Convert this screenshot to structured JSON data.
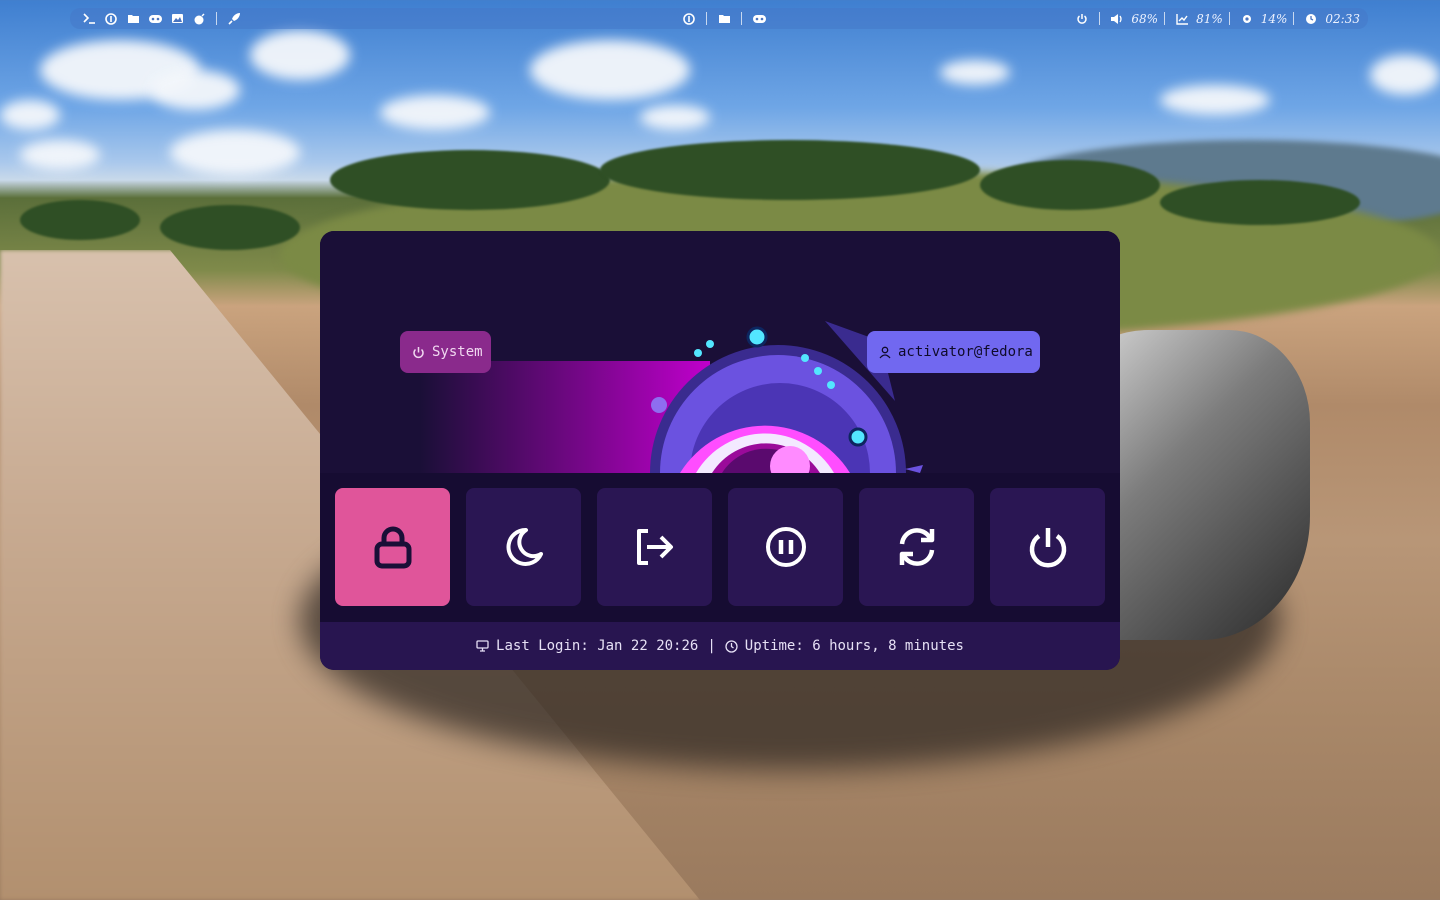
{
  "topbar": {
    "left_icons": [
      "terminal-icon",
      "fedora-icon",
      "folder-icon",
      "gamepad-icon",
      "image-icon",
      "bomb-icon",
      "rocket-icon"
    ],
    "center_icons": [
      "fedora-icon",
      "folder-icon",
      "gamepad-icon"
    ],
    "volume": "68%",
    "cpu": "81%",
    "memory": "14%",
    "clock": "02:33"
  },
  "power_menu": {
    "system_label": "System",
    "user_label": "activator@fedora",
    "buttons": [
      {
        "name": "lock",
        "icon": "lock-icon",
        "active": true
      },
      {
        "name": "sleep",
        "icon": "moon-icon",
        "active": false
      },
      {
        "name": "logout",
        "icon": "logout-icon",
        "active": false
      },
      {
        "name": "suspend",
        "icon": "pause-icon",
        "active": false
      },
      {
        "name": "reboot",
        "icon": "refresh-icon",
        "active": false
      },
      {
        "name": "shutdown",
        "icon": "power-icon",
        "active": false
      }
    ],
    "footer": {
      "last_login": "Last Login: Jan 22 20:26",
      "separator": "|",
      "uptime": "Uptime: 6 hours, 8 minutes"
    }
  },
  "colors": {
    "menu_bg": "#1b1038",
    "button_bg": "#2a1653",
    "active_button": "#e0559a",
    "system_pill": "#8a2a8c",
    "user_pill": "#7168f0",
    "footer_bg": "#281550"
  }
}
